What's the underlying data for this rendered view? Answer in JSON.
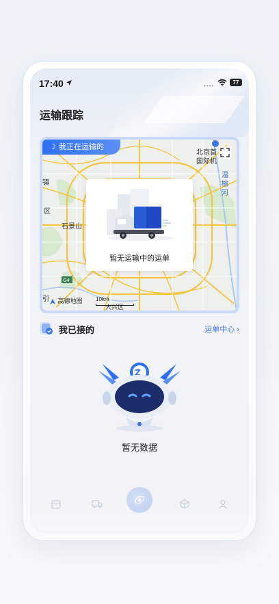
{
  "status_bar": {
    "time": "17:40",
    "battery": "77"
  },
  "page": {
    "title": "运输跟踪"
  },
  "map_card": {
    "tag_label": "我正在运输的",
    "empty_text": "暂无运输中的运单",
    "map_labels": {
      "beijing": "北京首",
      "airport": "国际机",
      "yu": "温",
      "yu2": "榆",
      "yu3": "河",
      "zhen": "镇",
      "qu": "区",
      "shijingshan": "石景山",
      "g4": "G4",
      "daxing": "大兴区",
      "yin": "引"
    },
    "logo": "高德地图",
    "scale": "10km"
  },
  "accepted": {
    "title": "我已接的",
    "link": "运单中心 ›"
  },
  "empty_state": {
    "text": "暂无数据"
  },
  "icons": {
    "location": "location-arrow-icon",
    "wifi": "wifi-icon",
    "expand": "expand-icon",
    "truck": "truck-icon",
    "check_doc": "check-doc-icon",
    "robot": "robot-mascot-icon"
  },
  "colors": {
    "accent": "#3c74e6",
    "tag_blue": "#2f6ff2",
    "map_road": "#f5c542"
  }
}
